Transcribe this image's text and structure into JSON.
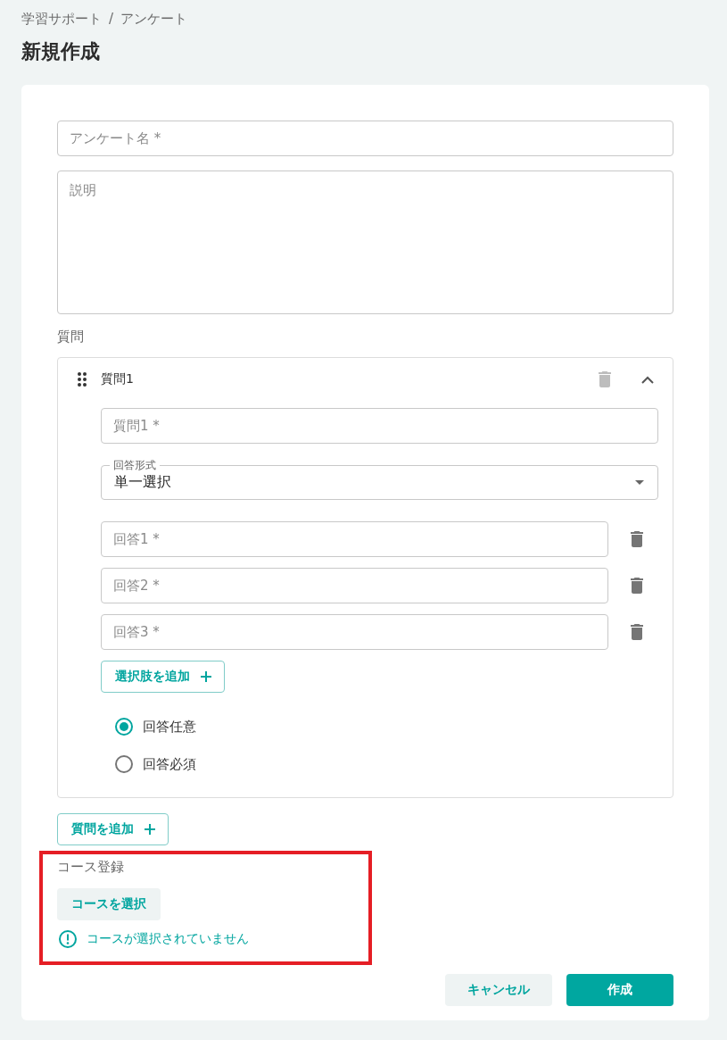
{
  "breadcrumb": {
    "items": [
      "学習サポート",
      "アンケート"
    ],
    "separator": "/"
  },
  "title": "新規作成",
  "form": {
    "name_field": {
      "placeholder": "アンケート名 *"
    },
    "description_field": {
      "placeholder": "説明"
    },
    "questions_label": "質問",
    "questions": [
      {
        "title": "質問1",
        "expanded": true,
        "delete_disabled": true,
        "question_field": {
          "placeholder": "質問1 *"
        },
        "answer_type": {
          "label": "回答形式",
          "value": "単一選択"
        },
        "answers": [
          {
            "placeholder": "回答1 *"
          },
          {
            "placeholder": "回答2 *"
          },
          {
            "placeholder": "回答3 *"
          }
        ],
        "add_choice_button": "選択肢を追加",
        "requirement_options": [
          {
            "label": "回答任意",
            "selected": true
          },
          {
            "label": "回答必須",
            "selected": false
          }
        ]
      }
    ],
    "add_question_button": "質問を追加",
    "course": {
      "highlighted": true,
      "label": "コース登録",
      "select_button": "コースを選択",
      "warning": "コースが選択されていません"
    }
  },
  "actions": {
    "cancel_button": "キャンセル",
    "create_button": "作成"
  }
}
